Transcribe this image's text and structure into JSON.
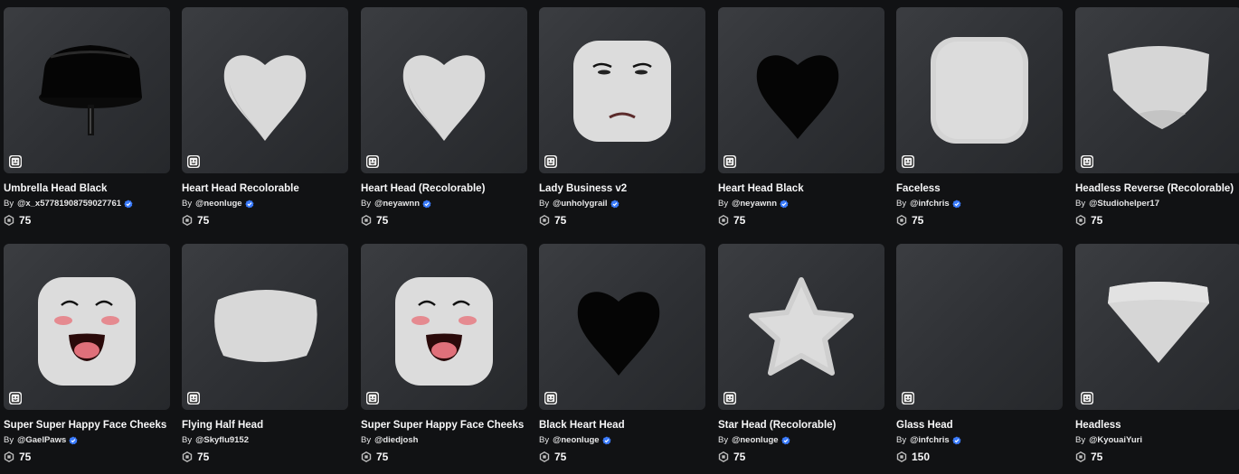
{
  "catalog": {
    "items": [
      {
        "title": "Umbrella Head Black",
        "by": "By",
        "creator": "@x_x57781908759027761",
        "verified": true,
        "price": "75",
        "art": "umbrella"
      },
      {
        "title": "Heart Head Recolorable",
        "by": "By",
        "creator": "@neonluge",
        "verified": true,
        "price": "75",
        "art": "heart-white"
      },
      {
        "title": "Heart Head (Recolorable)",
        "by": "By",
        "creator": "@neyawnn",
        "verified": true,
        "price": "75",
        "art": "heart-white"
      },
      {
        "title": "Lady Business v2",
        "by": "By",
        "creator": "@unholygrail",
        "verified": true,
        "price": "75",
        "art": "lady-face"
      },
      {
        "title": "Heart Head Black",
        "by": "By",
        "creator": "@neyawnn",
        "verified": true,
        "price": "75",
        "art": "heart-black"
      },
      {
        "title": "Faceless",
        "by": "By",
        "creator": "@infchris",
        "verified": true,
        "price": "75",
        "art": "blank-head"
      },
      {
        "title": "Headless Reverse (Recolorable)",
        "by": "By",
        "creator": "@Studiohelper17",
        "verified": false,
        "price": "75",
        "art": "headless-reverse"
      },
      {
        "title": "Super Super Happy Face Cheeks",
        "by": "By",
        "creator": "@GaelPaws",
        "verified": true,
        "price": "75",
        "art": "happy-face"
      },
      {
        "title": "Flying Half Head",
        "by": "By",
        "creator": "@Skyflu9152",
        "verified": false,
        "price": "75",
        "art": "half-head"
      },
      {
        "title": "Super Super Happy Face Cheeks",
        "by": "By",
        "creator": "@diedjosh",
        "verified": false,
        "price": "75",
        "art": "happy-face"
      },
      {
        "title": "Black Heart Head",
        "by": "By",
        "creator": "@neonluge",
        "verified": true,
        "price": "75",
        "art": "heart-black"
      },
      {
        "title": "Star Head (Recolorable)",
        "by": "By",
        "creator": "@neonluge",
        "verified": true,
        "price": "75",
        "art": "star"
      },
      {
        "title": "Glass Head",
        "by": "By",
        "creator": "@infchris",
        "verified": true,
        "price": "150",
        "art": "none"
      },
      {
        "title": "Headless",
        "by": "By",
        "creator": "@KyouaiYuri",
        "verified": false,
        "price": "75",
        "art": "headless"
      }
    ]
  },
  "colors": {
    "background": "#111214",
    "verified": "#3a7bfd",
    "text": "#f7f7f8"
  },
  "icons": {
    "avatar": "avatar-face-icon",
    "verified": "verified-badge-icon",
    "currency": "robux-icon"
  }
}
